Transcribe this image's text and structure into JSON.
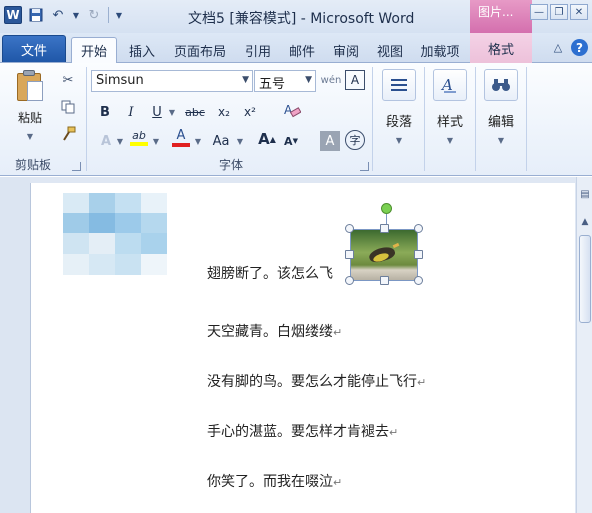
{
  "window": {
    "title": "文档5 [兼容模式] - Microsoft Word",
    "context_tab_header": "图片..."
  },
  "qat": {
    "logo": "W"
  },
  "tabs": {
    "file": "文件",
    "home": "开始",
    "insert": "插入",
    "page_layout": "页面布局",
    "references": "引用",
    "mailings": "邮件",
    "review": "审阅",
    "view": "视图",
    "addins": "加载项",
    "format": "格式"
  },
  "ribbon": {
    "clipboard": {
      "paste_label": "粘贴",
      "group_label": "剪贴板"
    },
    "font": {
      "font_name": "Simsun",
      "font_size": "五号",
      "group_label": "字体",
      "bold": "B",
      "italic": "I",
      "underline": "U",
      "strike": "abc",
      "subscript": "x₂",
      "superscript": "x²",
      "change_case": "Aa",
      "grow": "A",
      "shrink": "A",
      "char_shading": "A",
      "enclose": "字",
      "phonetic": "wén",
      "border": "A",
      "font_color": "A",
      "highlight": "ab",
      "clear": "A"
    },
    "paragraph": {
      "label": "段落"
    },
    "styles": {
      "label": "样式"
    },
    "editing": {
      "label": "编辑"
    }
  },
  "document": {
    "lines": [
      "翅膀断了。该怎么飞",
      "天空藏青。白烟缕缕",
      "没有脚的鸟。要怎么才能停止飞行",
      "手心的湛蓝。要怎样才肯褪去",
      "你笑了。而我在啜泣"
    ],
    "para_mark": "↵"
  },
  "colors": {
    "file_tab": "#2b5fae",
    "context_tab": "#e49ac6",
    "highlight_bar": "#ffff00",
    "font_color_bar": "#e02020"
  }
}
